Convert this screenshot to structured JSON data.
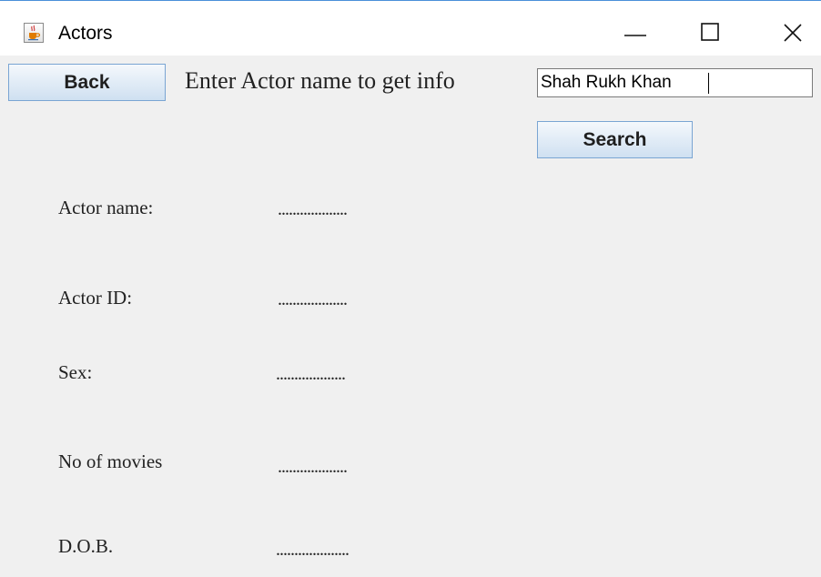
{
  "window": {
    "title": "Actors",
    "icon": "java-coffee-icon"
  },
  "toolbar": {
    "back_label": "Back",
    "prompt": "Enter Actor name to get info",
    "search_value": "Shah Rukh Khan",
    "search_label": "Search"
  },
  "fields": [
    {
      "label": "Actor name:",
      "value": "..................."
    },
    {
      "label": "Actor ID:",
      "value": "..................."
    },
    {
      "label": "Sex:",
      "value": "..................."
    },
    {
      "label": "No of movies",
      "value": "..................."
    },
    {
      "label": "D.O.B.",
      "value": "...................."
    }
  ],
  "colors": {
    "panel_background": "#f0f0f0",
    "button_border": "#7aa5d3",
    "window_border": "#4a90d9"
  }
}
